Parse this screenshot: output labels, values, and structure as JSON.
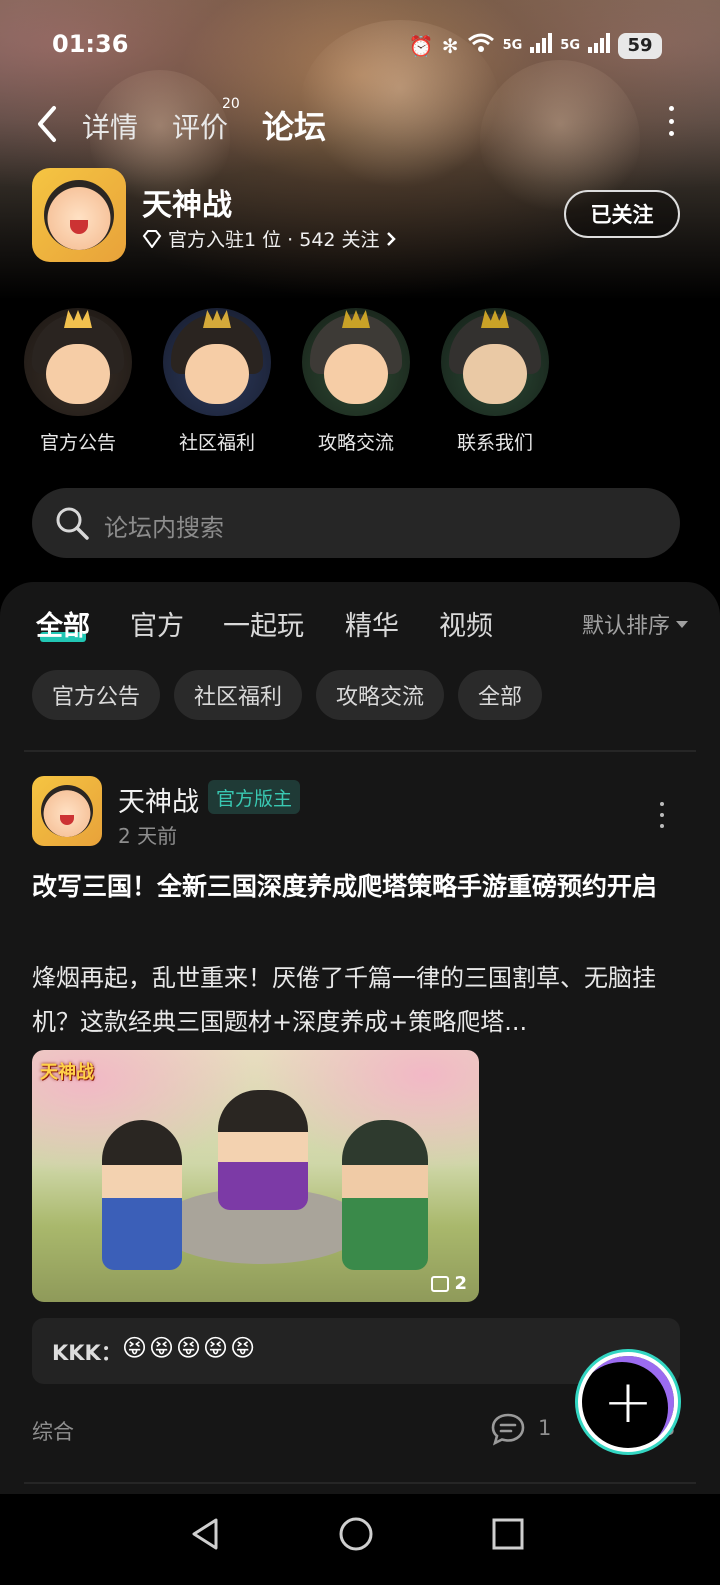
{
  "status": {
    "time": "01:36",
    "battery": "59",
    "net1": "5G",
    "net2": "5G"
  },
  "topnav": {
    "tabs": [
      {
        "label": "详情"
      },
      {
        "label": "评价",
        "badge": "20"
      },
      {
        "label": "论坛"
      }
    ],
    "active_tab": "论坛"
  },
  "game": {
    "name": "天神战",
    "meta": "官方入驻1 位 · 542 关注",
    "follow_label": "已关注"
  },
  "sections": [
    {
      "label": "官方公告"
    },
    {
      "label": "社区福利"
    },
    {
      "label": "攻略交流"
    },
    {
      "label": "联系我们"
    }
  ],
  "search": {
    "placeholder": "论坛内搜索"
  },
  "filter_tabs": [
    {
      "label": "全部"
    },
    {
      "label": "官方"
    },
    {
      "label": "一起玩"
    },
    {
      "label": "精华"
    },
    {
      "label": "视频"
    }
  ],
  "sort_label": "默认排序",
  "chips": [
    {
      "label": "官方公告"
    },
    {
      "label": "社区福利"
    },
    {
      "label": "攻略交流"
    },
    {
      "label": "全部"
    }
  ],
  "post": {
    "author": "天神战",
    "badge": "官方版主",
    "time": "2 天前",
    "title": "改写三国！全新三国深度养成爬塔策略手游重磅预约开启",
    "body": "烽烟再起，乱世重来！厌倦了千篇一律的三国割草、无脑挂机？这款经典三国题材+深度养成+策略爬塔...",
    "image_tag": "天神战",
    "image_count": "2",
    "comment_author": "KKK：",
    "comment_text": "😝😝😝😝😝",
    "category": "综合",
    "comments": "1",
    "likes": "3"
  }
}
